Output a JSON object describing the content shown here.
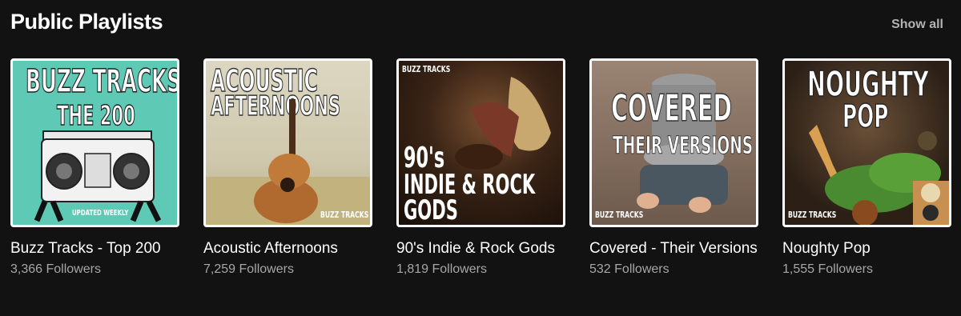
{
  "section": {
    "title": "Public Playlists",
    "show_all": "Show all"
  },
  "playlists": [
    {
      "title": "Buzz Tracks - Top 200",
      "followers": "3,366 Followers",
      "cover_text": [
        "BUZZ TRACKS",
        "THE 200",
        "UPDATED WEEKLY"
      ],
      "cover_bg": "#5ec9b4"
    },
    {
      "title": "Acoustic Afternoons",
      "followers": "7,259 Followers",
      "cover_text": [
        "ACOUSTIC",
        "AFTERNOONS",
        "BUZZ TRACKS"
      ],
      "cover_bg": "#d8d2b8"
    },
    {
      "title": "90's Indie & Rock Gods",
      "followers": "1,819 Followers",
      "cover_text": [
        "BUZZ TRACKS",
        "90's",
        "INDIE & ROCK",
        "GODS"
      ],
      "cover_bg": "#2a1a12"
    },
    {
      "title": "Covered - Their Versions",
      "followers": "532 Followers",
      "cover_text": [
        "COVERED",
        "THEIR VERSIONS",
        "BUZZ TRACKS"
      ],
      "cover_bg": "#8a7566"
    },
    {
      "title": "Noughty Pop",
      "followers": "1,555 Followers",
      "cover_text": [
        "NOUGHTY",
        "POP",
        "BUZZ TRACKS"
      ],
      "cover_bg": "#3a2a1c"
    }
  ]
}
